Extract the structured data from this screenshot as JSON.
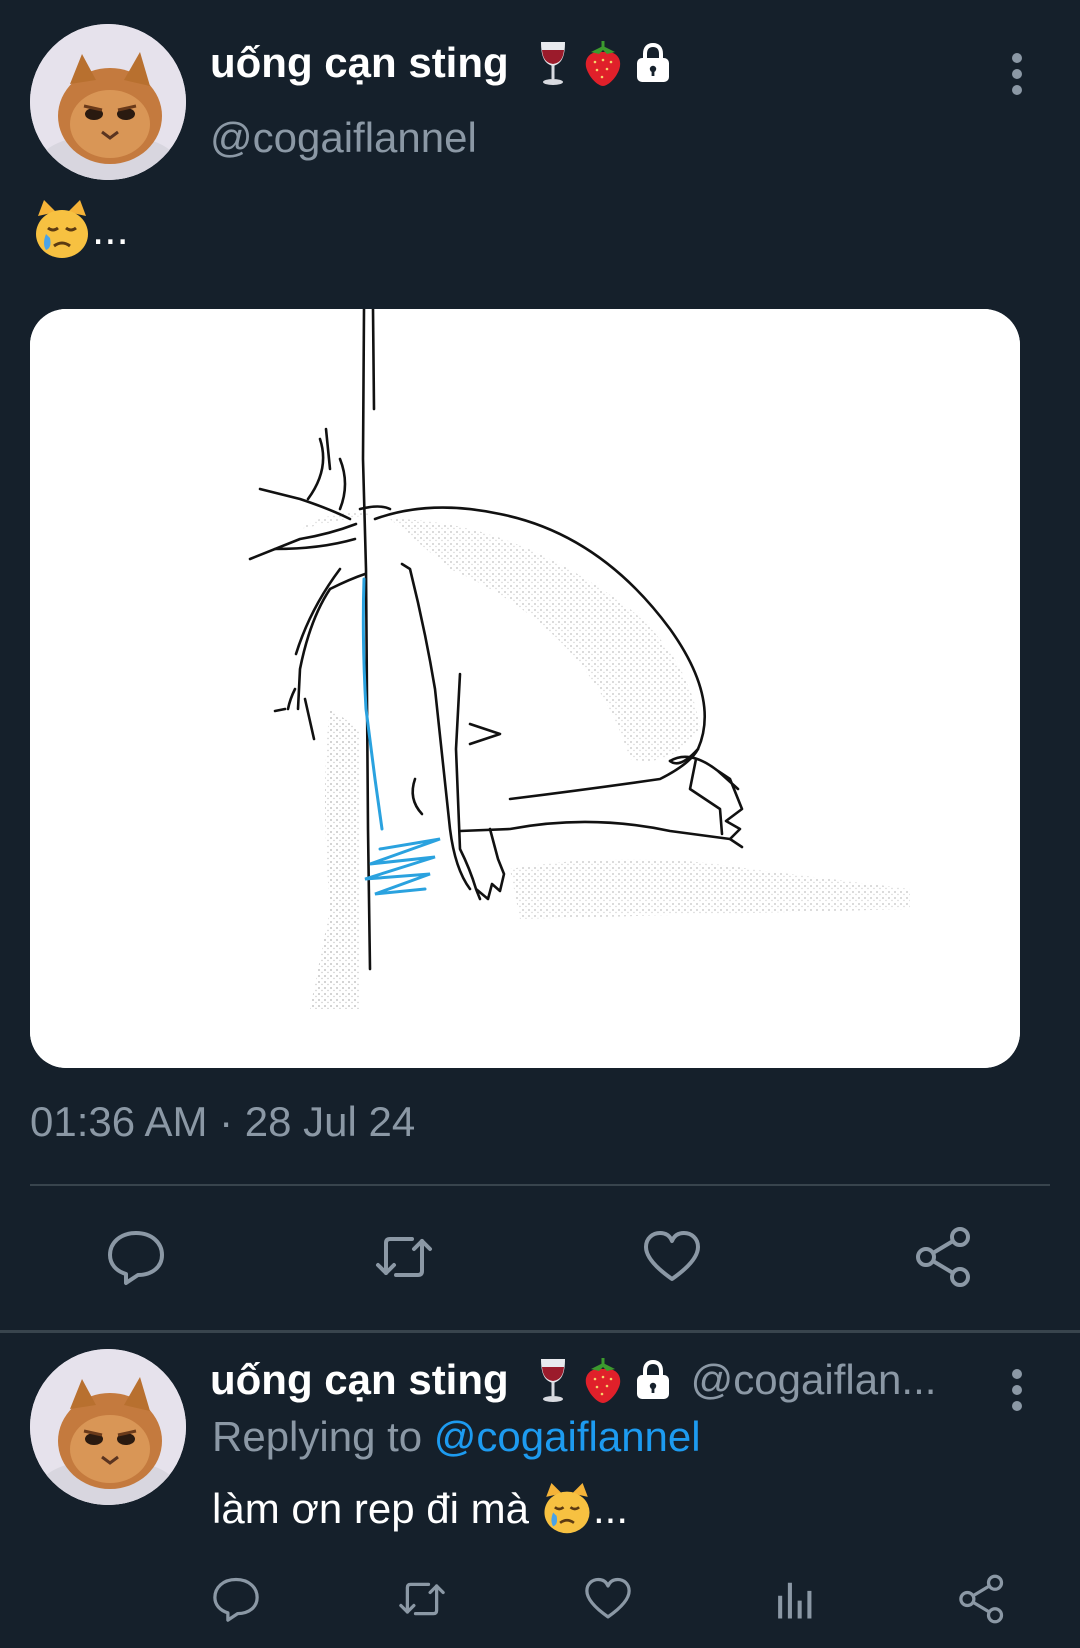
{
  "tweet": {
    "display_name": "uống cạn sting",
    "handle": "@cogaiflannel",
    "badges": [
      "wine-glass-icon",
      "strawberry-icon",
      "lock-icon"
    ],
    "text": "...",
    "text_emoji": "crying-cat-face-icon",
    "timestamp": "01:36 AM · 28 Jul 24",
    "actions": [
      "reply-icon",
      "retweet-icon",
      "like-icon",
      "share-icon"
    ]
  },
  "reply": {
    "display_name": "uống cạn sting",
    "handle": "@cogaiflan...",
    "replying_prefix": "Replying to",
    "replying_to": "@cogaiflannel",
    "text": "làm ơn rep đi mà",
    "text_suffix": "...",
    "text_emoji": "crying-cat-face-icon",
    "actions": [
      "reply-icon",
      "retweet-icon",
      "like-icon",
      "analytics-icon",
      "share-icon"
    ]
  },
  "colors": {
    "background": "#15202b",
    "secondary_text": "#8b98a5",
    "link": "#1d9bf0",
    "divider": "#38444d"
  }
}
